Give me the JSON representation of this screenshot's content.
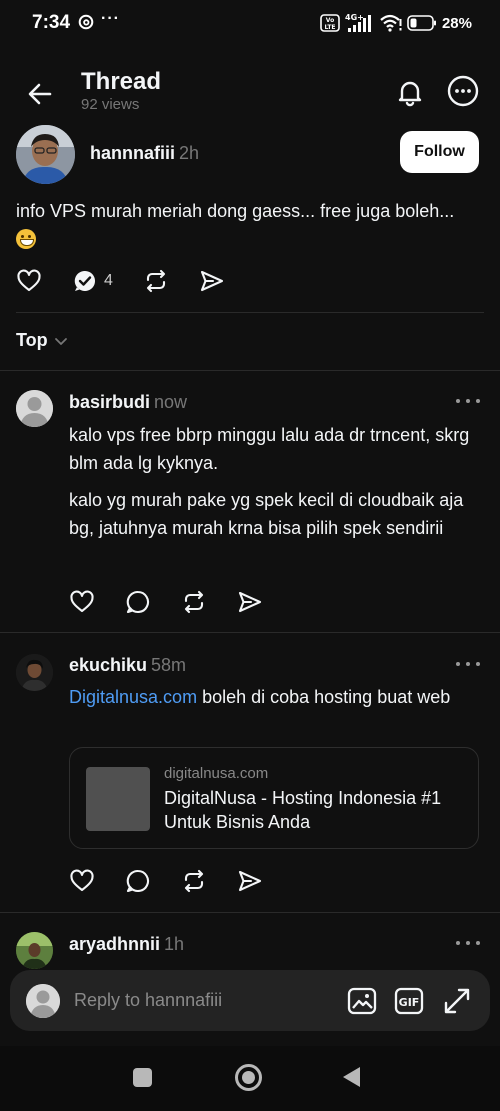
{
  "status_bar": {
    "time": "7:34",
    "network": "4G+",
    "volte": "Vo LTE",
    "battery": "28%"
  },
  "header": {
    "title": "Thread",
    "views": "92 views"
  },
  "post": {
    "username": "hannnafiii",
    "time": "2h",
    "follow_label": "Follow",
    "text": "info VPS murah meriah dong gaess... free juga boleh...",
    "reply_count": "4"
  },
  "sort": {
    "label": "Top"
  },
  "replies": [
    {
      "username": "basirbudi",
      "time": "now",
      "paragraphs": [
        "kalo vps free bbrp minggu lalu ada dr trncent, skrg blm ada lg kyknya.",
        "kalo yg murah pake yg spek kecil di cloudbaik aja bg, jatuhnya murah krna bisa pilih spek sendirii"
      ]
    },
    {
      "username": "ekuchiku",
      "time": "58m",
      "link_text": "Digitalnusa.com",
      "text": " boleh di coba hosting buat web",
      "card": {
        "domain": "digitalnusa.com",
        "title": "DigitalNusa - Hosting Indonesia #1 Untuk Bisnis Anda"
      }
    },
    {
      "username": "aryadhnnii",
      "time": "1h"
    }
  ],
  "composer": {
    "placeholder": "Reply to hannnafiii"
  },
  "icons": {
    "back": "arrow-left-icon",
    "bell": "bell-icon",
    "more": "more-circle-icon",
    "like": "heart-icon",
    "reply": "comment-icon",
    "repost": "repost-icon",
    "share": "send-icon",
    "image": "image-icon",
    "gif": "gif-icon",
    "expand": "expand-icon"
  },
  "colors": {
    "background": "#101010",
    "text": "#f3f5f7",
    "muted": "#777777",
    "link": "#4f9cf4",
    "follow_bg": "#ffffff"
  }
}
